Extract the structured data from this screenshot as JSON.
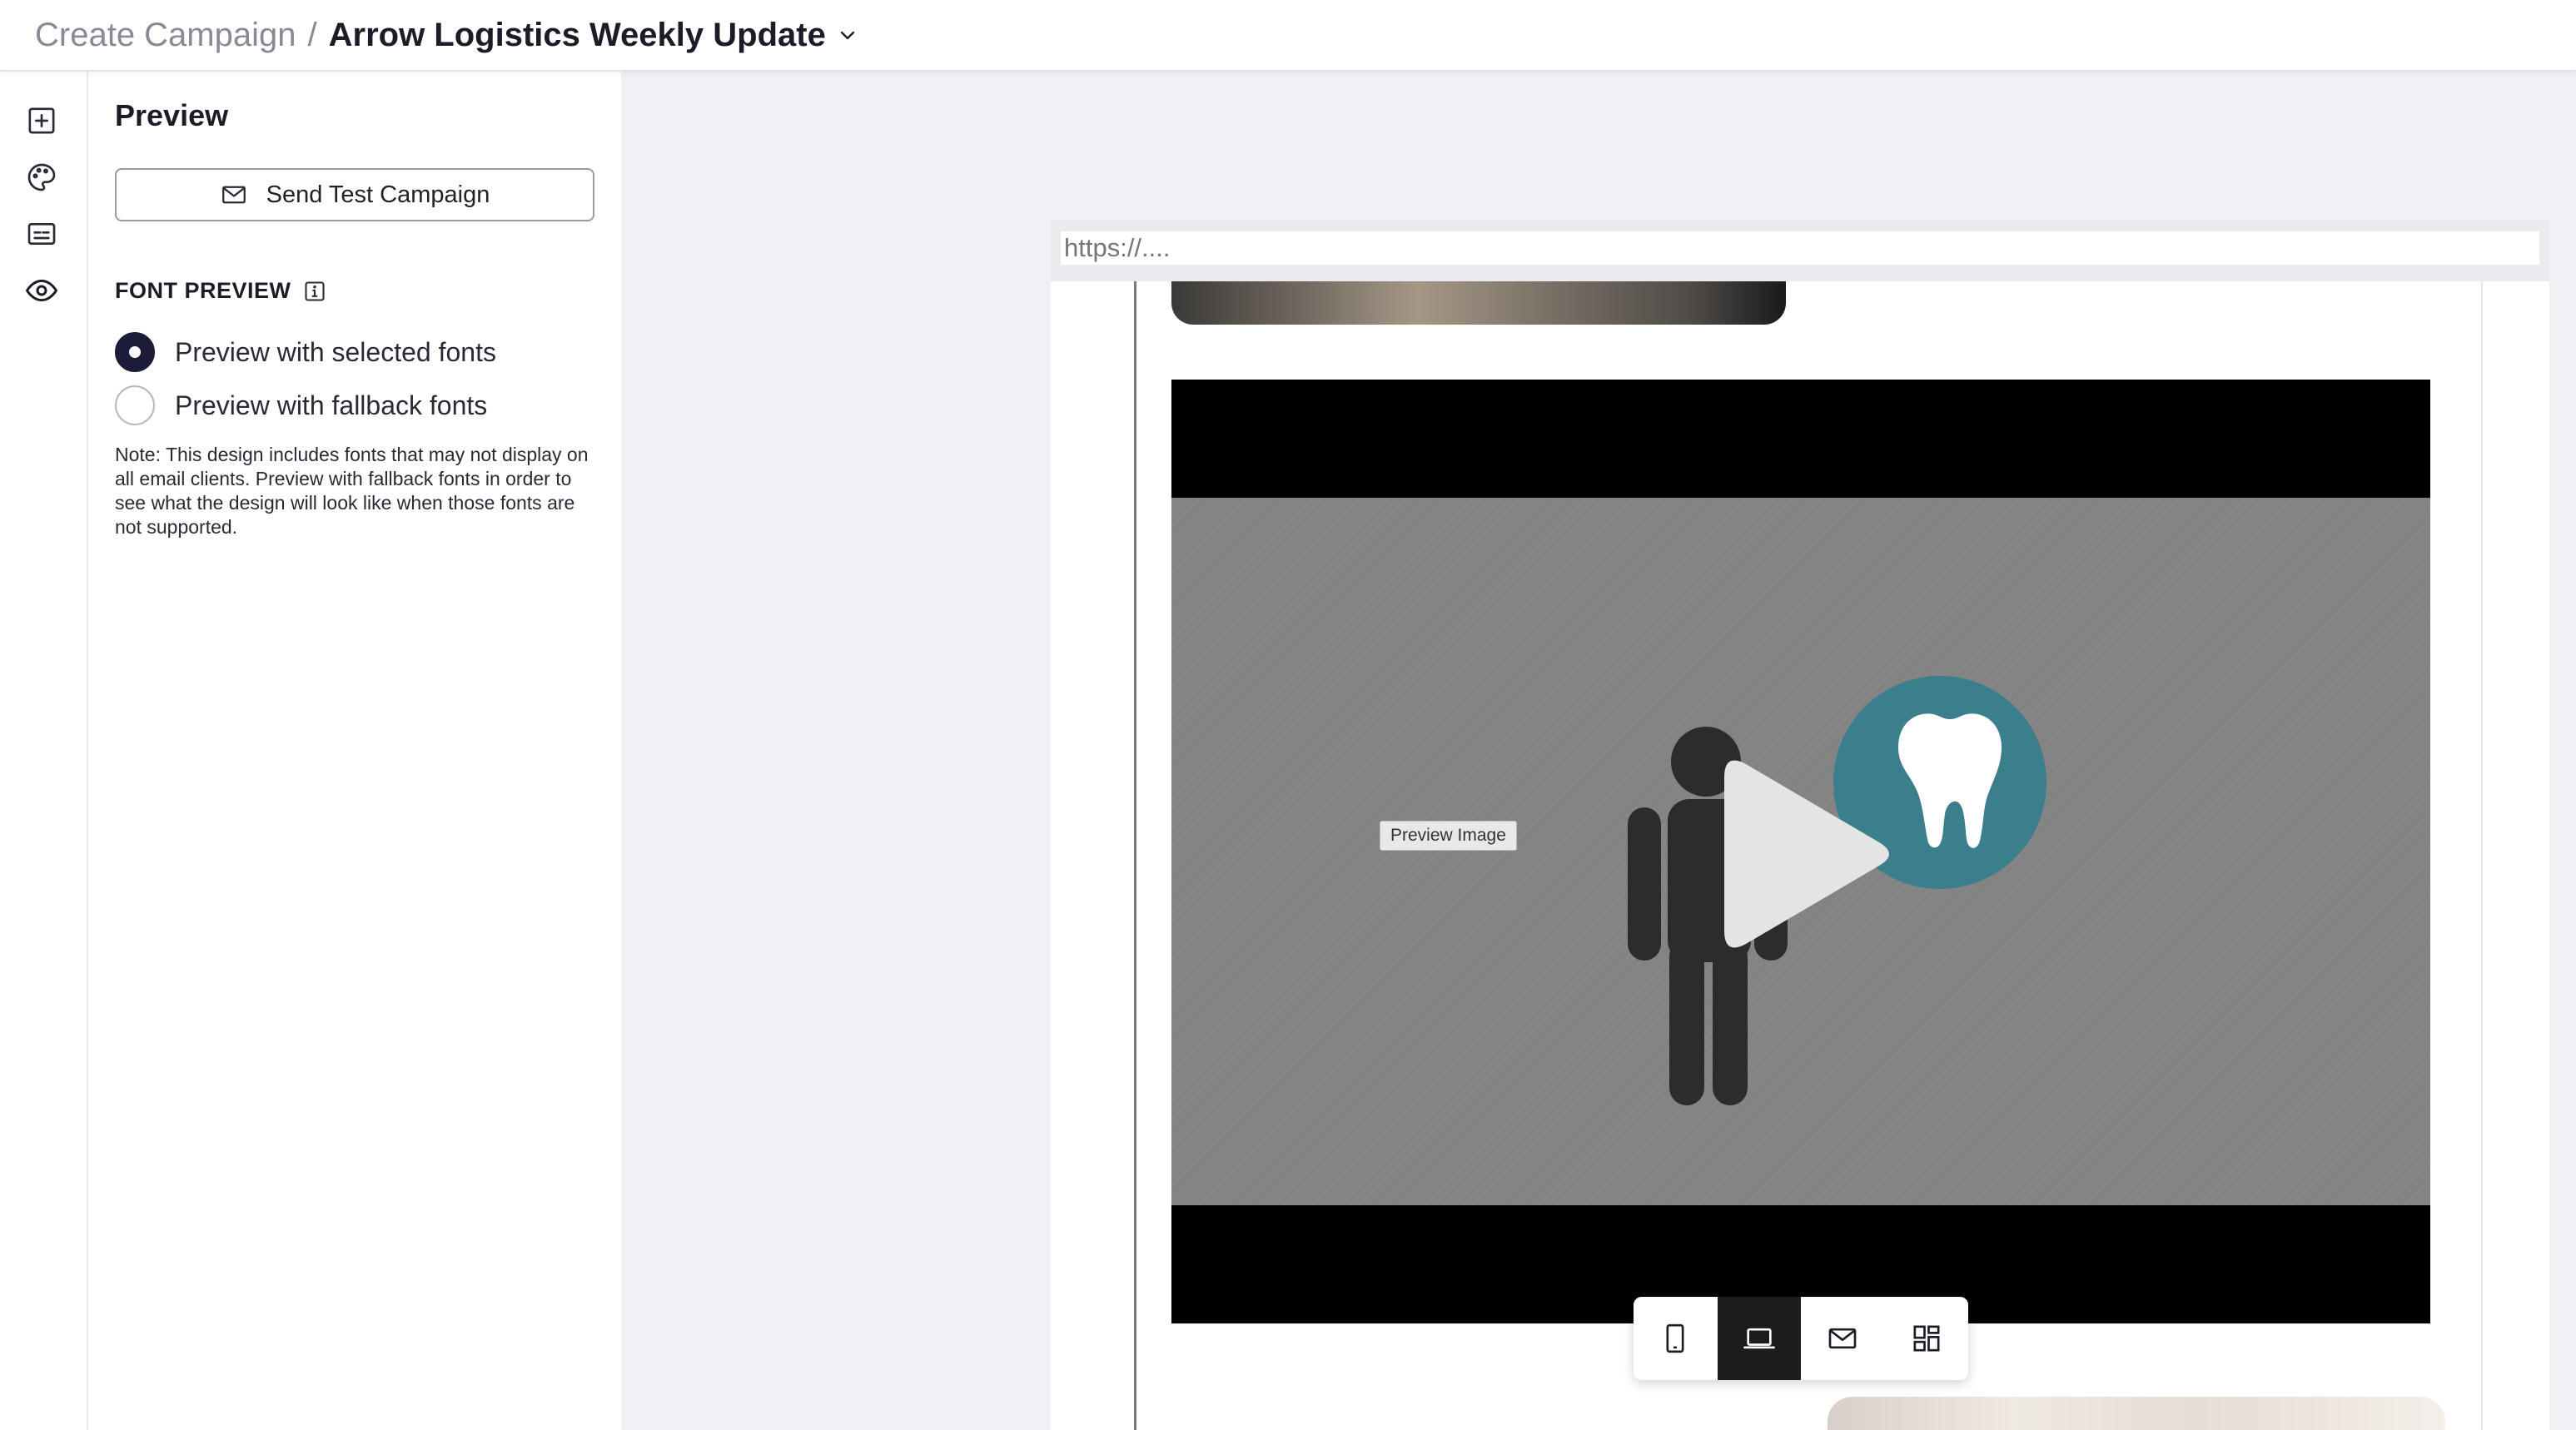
{
  "header": {
    "breadcrumb_parent": "Create Campaign",
    "separator": "/",
    "title": "Arrow Logistics Weekly Update",
    "title_dropdown_icon": "chevron-down-icon"
  },
  "rail": {
    "items": [
      {
        "icon": "add-square-icon",
        "name": "add"
      },
      {
        "icon": "palette-icon",
        "name": "styles"
      },
      {
        "icon": "caption-icon",
        "name": "content"
      },
      {
        "icon": "eye-icon",
        "name": "preview",
        "active": true
      }
    ]
  },
  "panel": {
    "title": "Preview",
    "send_test_label": "Send Test Campaign",
    "send_test_icon": "mail-icon",
    "font_preview_label": "FONT PREVIEW",
    "font_preview_info_icon": "info-icon",
    "radios": [
      {
        "label": "Preview with selected fonts",
        "checked": true
      },
      {
        "label": "Preview with fallback fonts",
        "checked": false
      }
    ],
    "note": "Note: This design includes fonts that may not display on all email clients. Preview with fallback fonts in order to see what the design will look like when those fonts are not supported."
  },
  "preview": {
    "url_placeholder": "https://....",
    "video_overlay_label": "Preview Image",
    "video_play_icon": "play-icon",
    "video_thumbnail_subject": "person-with-tooth-icon"
  },
  "device_toolbar": {
    "items": [
      {
        "icon": "mobile-icon",
        "name": "mobile",
        "active": false
      },
      {
        "icon": "laptop-icon",
        "name": "desktop",
        "active": true
      },
      {
        "icon": "mail-icon",
        "name": "inbox",
        "active": false
      },
      {
        "icon": "grid-icon",
        "name": "all",
        "active": false
      }
    ]
  },
  "colors": {
    "accent_dark": "#1c1c3a",
    "canvas_bg": "#f0f0f5",
    "tooth_circle": "#3b7f8d"
  }
}
